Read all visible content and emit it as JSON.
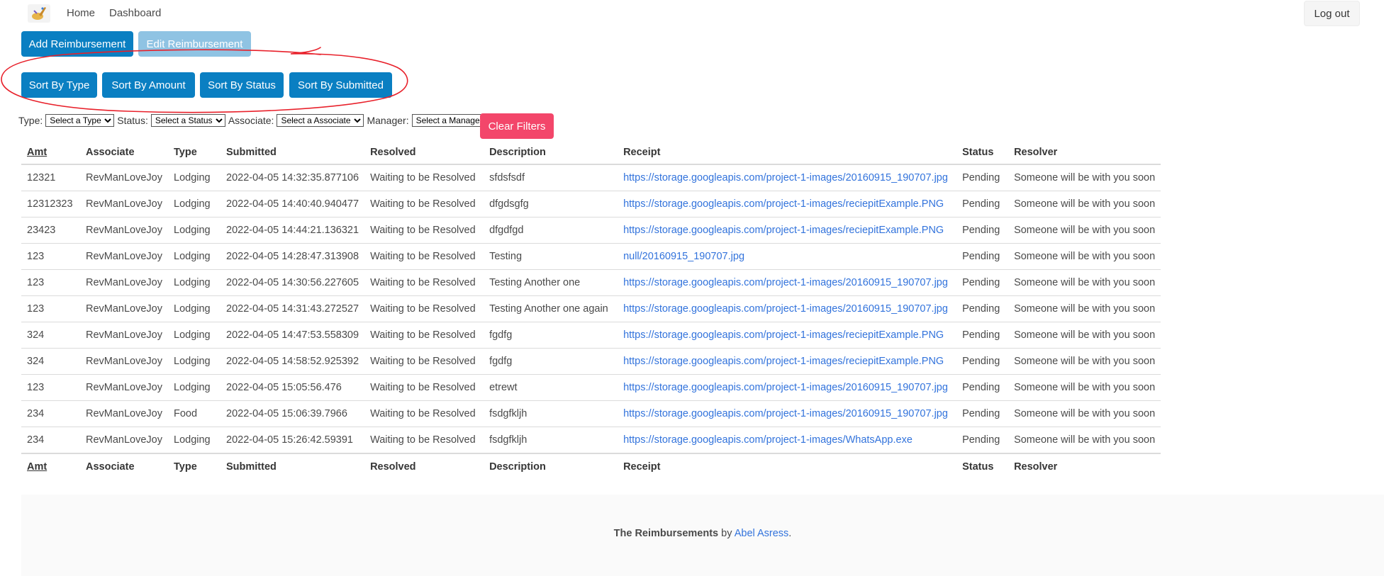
{
  "nav": {
    "home": "Home",
    "dashboard": "Dashboard",
    "logout": "Log out"
  },
  "actions": {
    "add": "Add Reimbursement",
    "edit": "Edit Reimbursement"
  },
  "sort": {
    "type": "Sort By Type",
    "amount": "Sort By Amount",
    "status": "Sort By Status",
    "submitted": "Sort By Submitted"
  },
  "filters": {
    "type_label": "Type:",
    "type_value": "Select a Type",
    "status_label": "Status:",
    "status_value": "Select a Status",
    "associate_label": "Associate:",
    "associate_value": "Select a Associate",
    "manager_label": "Manager:",
    "manager_value": "Select a Manager",
    "clear": "Clear Filters"
  },
  "table": {
    "headers": {
      "amt": "Amt",
      "associate": "Associate",
      "type": "Type",
      "submitted": "Submitted",
      "resolved": "Resolved",
      "description": "Description",
      "receipt": "Receipt",
      "status": "Status",
      "resolver": "Resolver"
    },
    "rows": [
      {
        "amt": "12321",
        "associate": "RevManLoveJoy",
        "type": "Lodging",
        "submitted": "2022-04-05 14:32:35.877106",
        "resolved": "Waiting to be Resolved",
        "description": "sfdsfsdf",
        "receipt": "https://storage.googleapis.com/project-1-images/20160915_190707.jpg",
        "status": "Pending",
        "resolver": "Someone will be with you soon"
      },
      {
        "amt": "12312323",
        "associate": "RevManLoveJoy",
        "type": "Lodging",
        "submitted": "2022-04-05 14:40:40.940477",
        "resolved": "Waiting to be Resolved",
        "description": "dfgdsgfg",
        "receipt": "https://storage.googleapis.com/project-1-images/reciepitExample.PNG",
        "status": "Pending",
        "resolver": "Someone will be with you soon"
      },
      {
        "amt": "23423",
        "associate": "RevManLoveJoy",
        "type": "Lodging",
        "submitted": "2022-04-05 14:44:21.136321",
        "resolved": "Waiting to be Resolved",
        "description": "dfgdfgd",
        "receipt": "https://storage.googleapis.com/project-1-images/reciepitExample.PNG",
        "status": "Pending",
        "resolver": "Someone will be with you soon"
      },
      {
        "amt": "123",
        "associate": "RevManLoveJoy",
        "type": "Lodging",
        "submitted": "2022-04-05 14:28:47.313908",
        "resolved": "Waiting to be Resolved",
        "description": "Testing",
        "receipt": "null/20160915_190707.jpg",
        "status": "Pending",
        "resolver": "Someone will be with you soon"
      },
      {
        "amt": "123",
        "associate": "RevManLoveJoy",
        "type": "Lodging",
        "submitted": "2022-04-05 14:30:56.227605",
        "resolved": "Waiting to be Resolved",
        "description": "Testing Another one",
        "receipt": "https://storage.googleapis.com/project-1-images/20160915_190707.jpg",
        "status": "Pending",
        "resolver": "Someone will be with you soon"
      },
      {
        "amt": "123",
        "associate": "RevManLoveJoy",
        "type": "Lodging",
        "submitted": "2022-04-05 14:31:43.272527",
        "resolved": "Waiting to be Resolved",
        "description": "Testing Another one again",
        "receipt": "https://storage.googleapis.com/project-1-images/20160915_190707.jpg",
        "status": "Pending",
        "resolver": "Someone will be with you soon"
      },
      {
        "amt": "324",
        "associate": "RevManLoveJoy",
        "type": "Lodging",
        "submitted": "2022-04-05 14:47:53.558309",
        "resolved": "Waiting to be Resolved",
        "description": "fgdfg",
        "receipt": "https://storage.googleapis.com/project-1-images/reciepitExample.PNG",
        "status": "Pending",
        "resolver": "Someone will be with you soon"
      },
      {
        "amt": "324",
        "associate": "RevManLoveJoy",
        "type": "Lodging",
        "submitted": "2022-04-05 14:58:52.925392",
        "resolved": "Waiting to be Resolved",
        "description": "fgdfg",
        "receipt": "https://storage.googleapis.com/project-1-images/reciepitExample.PNG",
        "status": "Pending",
        "resolver": "Someone will be with you soon"
      },
      {
        "amt": "123",
        "associate": "RevManLoveJoy",
        "type": "Lodging",
        "submitted": "2022-04-05 15:05:56.476",
        "resolved": "Waiting to be Resolved",
        "description": "etrewt",
        "receipt": "https://storage.googleapis.com/project-1-images/20160915_190707.jpg",
        "status": "Pending",
        "resolver": "Someone will be with you soon"
      },
      {
        "amt": "234",
        "associate": "RevManLoveJoy",
        "type": "Food",
        "submitted": "2022-04-05 15:06:39.7966",
        "resolved": "Waiting to be Resolved",
        "description": "fsdgfkljh",
        "receipt": "https://storage.googleapis.com/project-1-images/20160915_190707.jpg",
        "status": "Pending",
        "resolver": "Someone will be with you soon"
      },
      {
        "amt": "234",
        "associate": "RevManLoveJoy",
        "type": "Lodging",
        "submitted": "2022-04-05 15:26:42.59391",
        "resolved": "Waiting to be Resolved",
        "description": "fsdgfkljh",
        "receipt": "https://storage.googleapis.com/project-1-images/WhatsApp.exe",
        "status": "Pending",
        "resolver": "Someone will be with you soon"
      }
    ]
  },
  "footer": {
    "brand": "The Reimbursements",
    "by": "by",
    "author": "Abel Asress",
    "period": "."
  },
  "colors": {
    "primary": "#0a7fc2",
    "primary_disabled": "#8fc3e3",
    "danger": "#f3466a",
    "link": "#3273dc",
    "annotation": "#e8202a"
  },
  "icons": {
    "logo": "logo-icon"
  }
}
